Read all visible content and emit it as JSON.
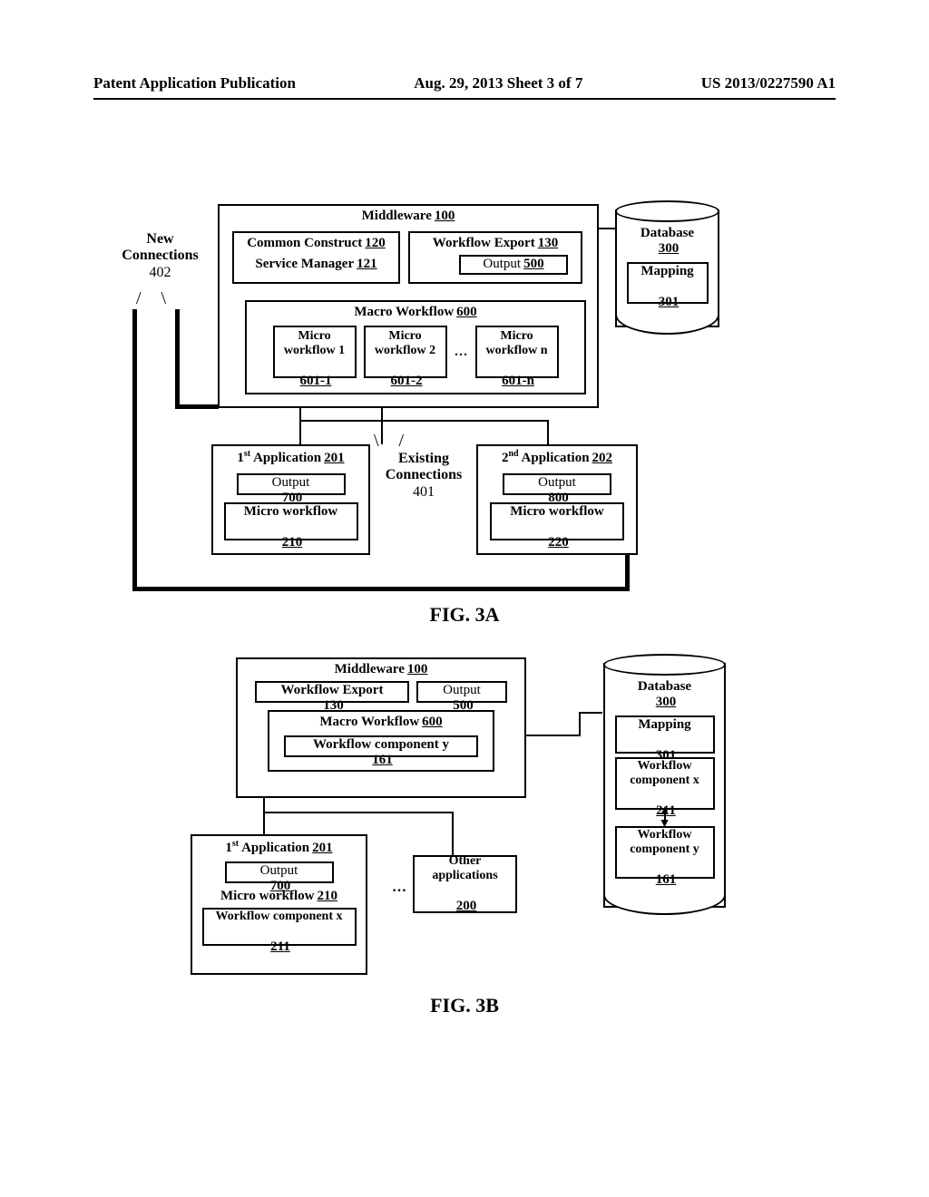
{
  "header": {
    "left": "Patent Application Publication",
    "center": "Aug. 29, 2013  Sheet 3 of 7",
    "right": "US 2013/0227590 A1"
  },
  "figA": {
    "middleware": {
      "label": "Middleware",
      "ref": "100"
    },
    "common_construct": {
      "label": "Common Construct",
      "ref": "120"
    },
    "service_manager": {
      "label": "Service Manager",
      "ref": "121"
    },
    "workflow_export": {
      "label": "Workflow Export",
      "ref": "130"
    },
    "output_mw": {
      "label": "Output",
      "ref": "500"
    },
    "macro": {
      "label": "Macro Workflow",
      "ref": "600"
    },
    "micro1": {
      "label": "Micro workflow 1",
      "ref": "601-1"
    },
    "micro2": {
      "label": "Micro workflow 2",
      "ref": "601-2"
    },
    "micron": {
      "label": "Micro workflow n",
      "ref": "601-n"
    },
    "ellipsis": "…",
    "new_conn": {
      "label": "New Connections",
      "ref": "402"
    },
    "existing_conn": {
      "label": "Existing Connections",
      "ref": "401"
    },
    "database": {
      "label": "Database",
      "ref": "300"
    },
    "mapping": {
      "label": "Mapping",
      "ref": "301"
    },
    "app1": {
      "label": "1ˢᵗ Application",
      "ref": "201"
    },
    "app1_out": {
      "label": "Output",
      "ref": "700"
    },
    "app1_micro": {
      "label": "Micro workflow",
      "ref": "210"
    },
    "app2": {
      "label": "2ⁿᵈ Application",
      "ref": "202"
    },
    "app2_out": {
      "label": "Output",
      "ref": "800"
    },
    "app2_micro": {
      "label": "Micro workflow",
      "ref": "220"
    },
    "caption": "FIG. 3A"
  },
  "figB": {
    "middleware": {
      "label": "Middleware",
      "ref": "100"
    },
    "workflow_export": {
      "label": "Workflow Export",
      "ref": "130"
    },
    "output_mw": {
      "label": "Output",
      "ref": "500"
    },
    "macro": {
      "label": "Macro Workflow",
      "ref": "600"
    },
    "wf_comp_y_mw": {
      "label": "Workflow component y",
      "ref": "161"
    },
    "database": {
      "label": "Database",
      "ref": "300"
    },
    "mapping": {
      "label": "Mapping",
      "ref": "301"
    },
    "db_wf_x": {
      "label": "Workflow component x",
      "ref": "211"
    },
    "db_wf_y": {
      "label": "Workflow component y",
      "ref": "161"
    },
    "app1": {
      "label": "1ˢᵗ Application",
      "ref": "201"
    },
    "app1_out": {
      "label": "Output",
      "ref": "700"
    },
    "app1_micro": {
      "label": "Micro workflow",
      "ref": "210"
    },
    "app1_wf_x": {
      "label": "Workflow component x",
      "ref": "211"
    },
    "other_apps": {
      "label": "Other applications",
      "ref": "200"
    },
    "ellipsis": "…",
    "caption": "FIG. 3B"
  }
}
